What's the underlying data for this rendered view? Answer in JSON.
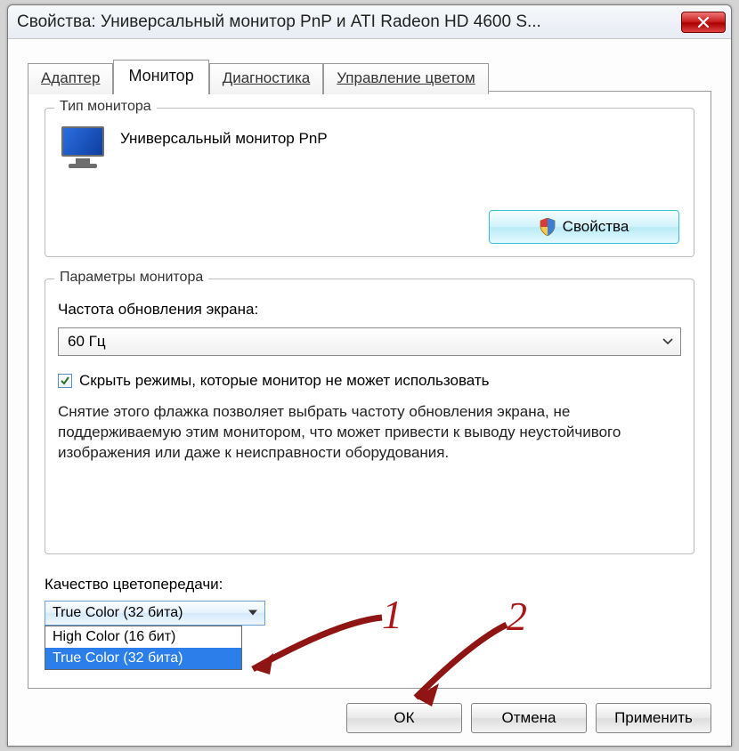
{
  "window": {
    "title": "Свойства: Универсальный монитор PnP и ATI Radeon HD 4600 S..."
  },
  "tabs": [
    {
      "label": "Адаптер"
    },
    {
      "label": "Монитор"
    },
    {
      "label": "Диагностика"
    },
    {
      "label": "Управление цветом"
    }
  ],
  "monitor_type": {
    "group_title": "Тип монитора",
    "name": "Универсальный монитор PnP",
    "properties_button": "Свойства"
  },
  "monitor_settings": {
    "group_title": "Параметры монитора",
    "refresh_label": "Частота обновления экрана:",
    "refresh_value": "60 Гц",
    "hide_modes_label": "Скрыть режимы, которые монитор не может использовать",
    "help_text": "Снятие этого флажка позволяет выбрать частоту обновления экрана, не поддерживаемую этим монитором, что может привести к выводу неустойчивого изображения или даже к неисправности оборудования."
  },
  "color": {
    "label": "Качество цветопередачи:",
    "selected": "True Color (32 бита)",
    "options": [
      "High Color (16 бит)",
      "True Color (32 бита)"
    ]
  },
  "buttons": {
    "ok": "ОК",
    "cancel": "Отмена",
    "apply": "Применить"
  },
  "annotations": {
    "a1": "1",
    "a2": "2"
  }
}
